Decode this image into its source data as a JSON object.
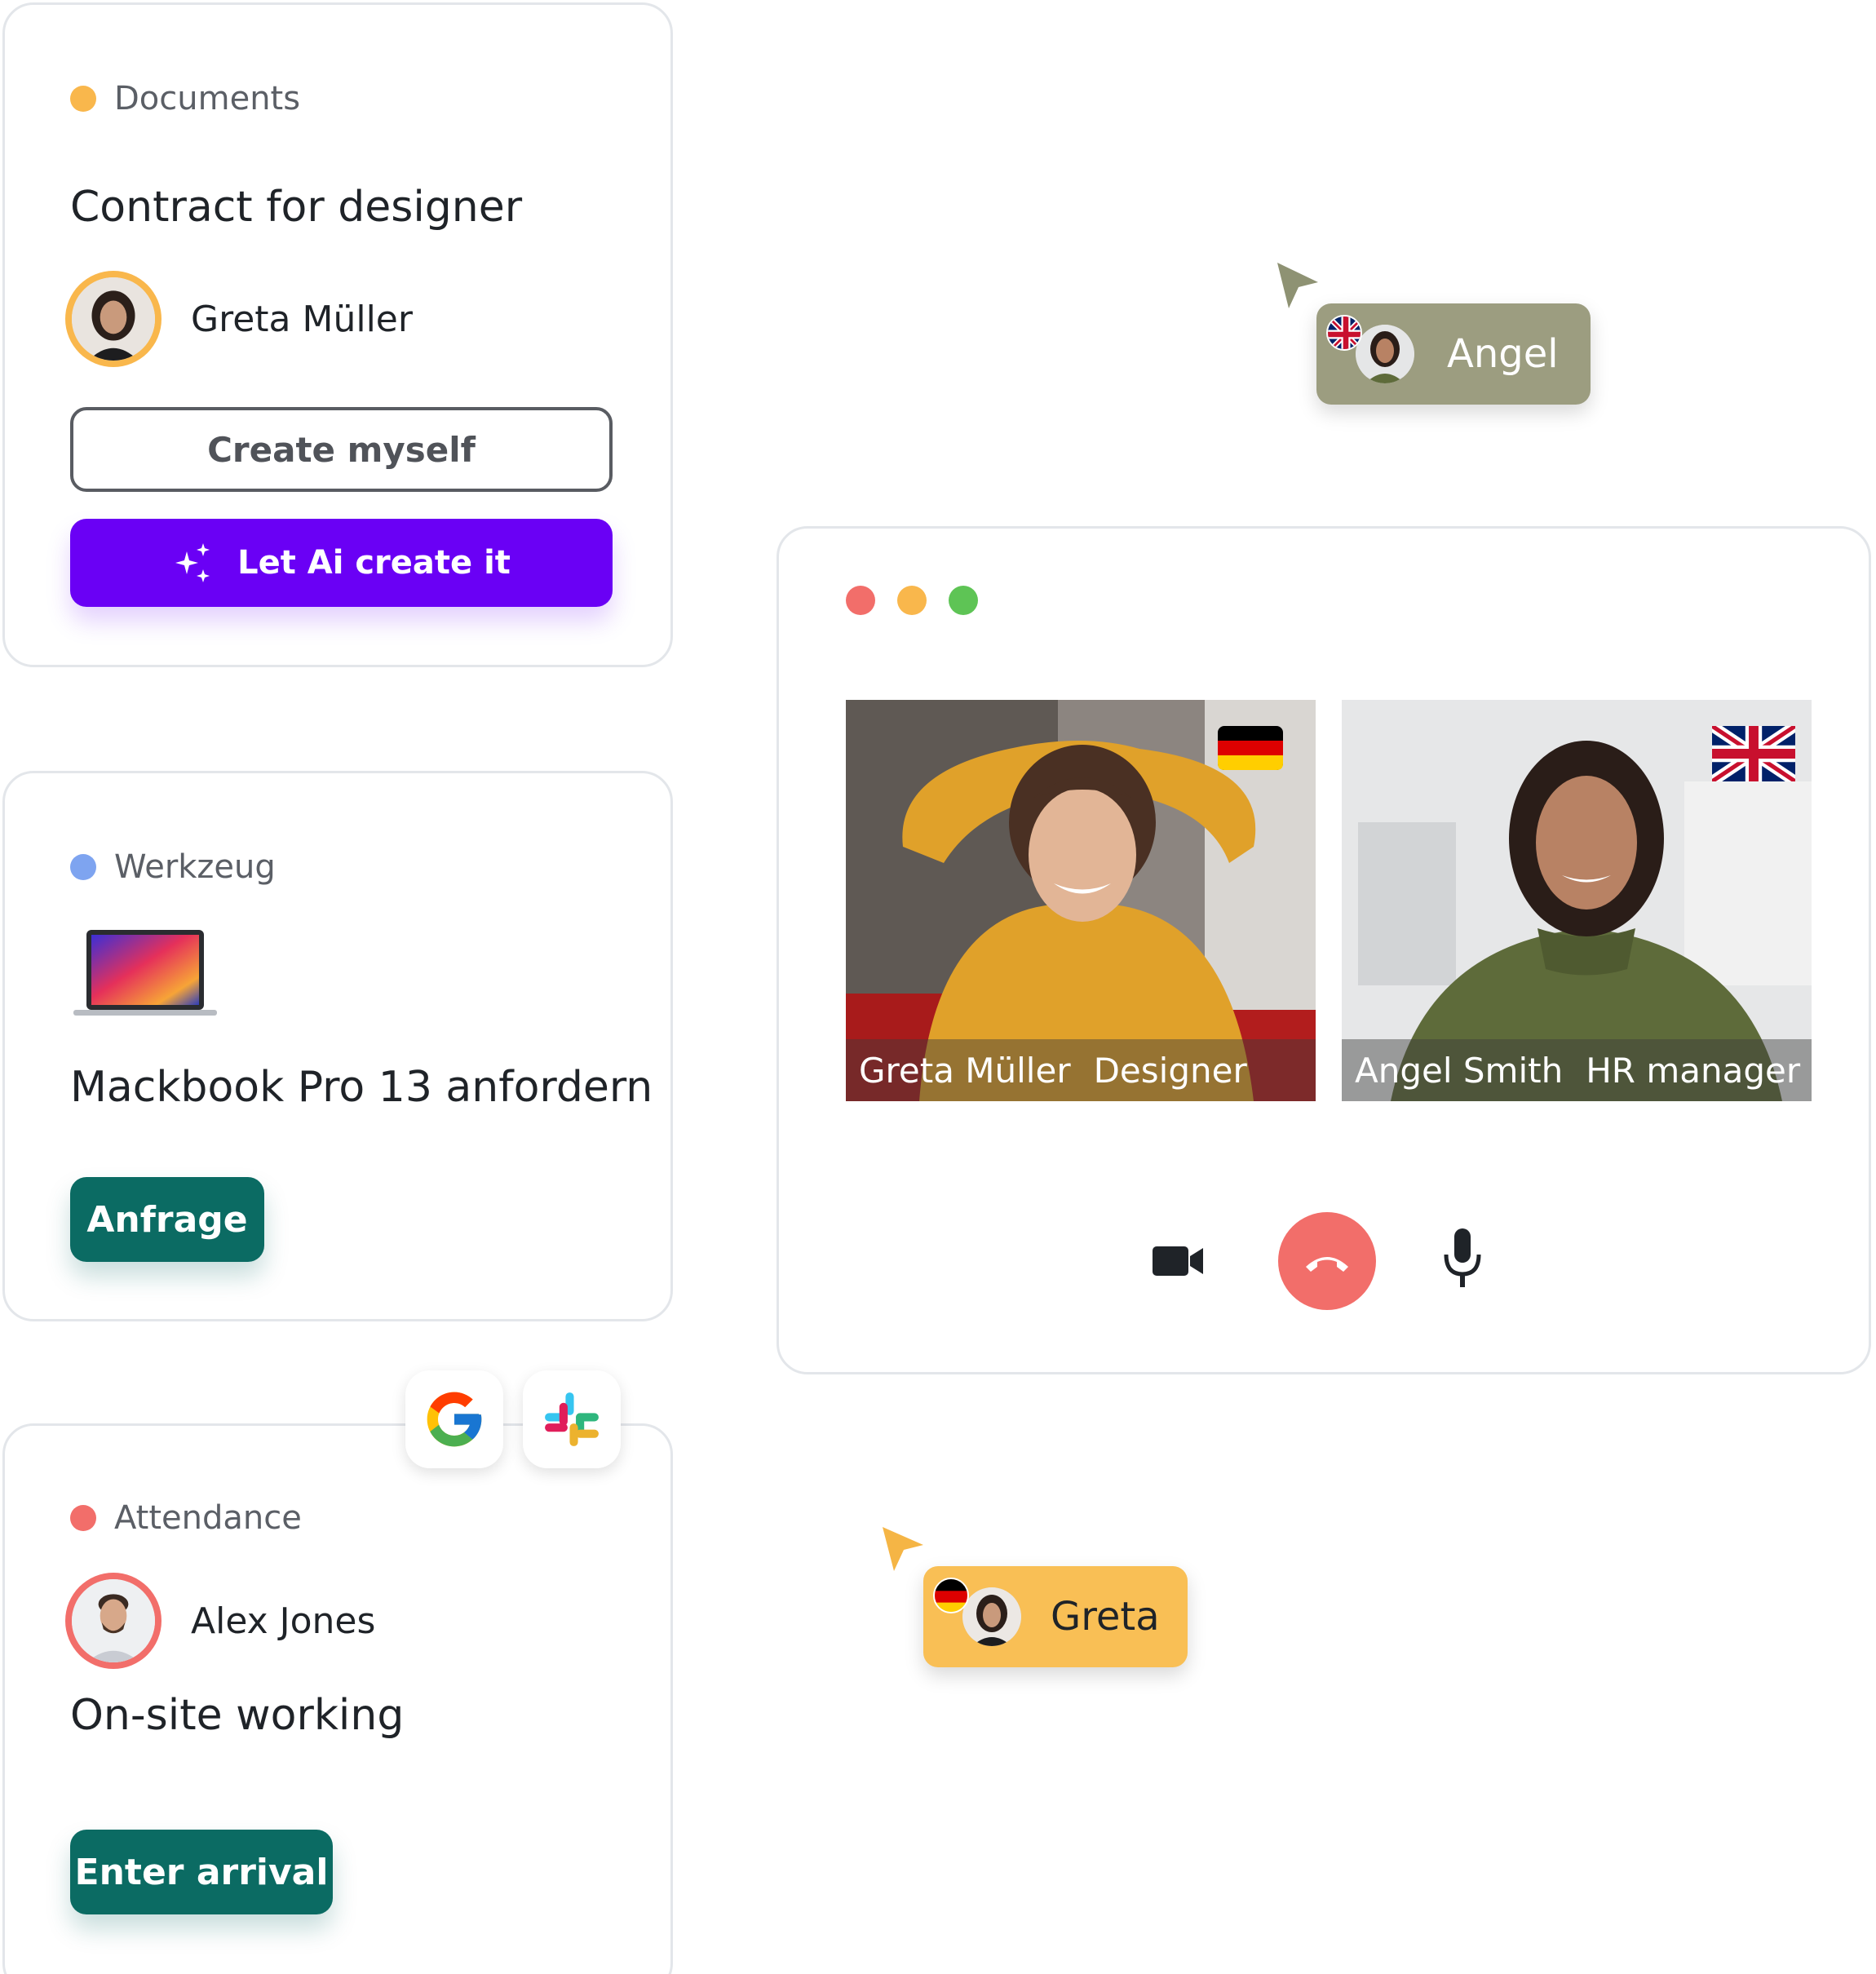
{
  "documents_card": {
    "category": "Documents",
    "title": "Contract for designer",
    "person": "Greta Müller",
    "create_myself": "Create myself",
    "let_ai": "Let Ai create it"
  },
  "werkzeug_card": {
    "category": "Werkzeug",
    "title": "Mackbook Pro 13 anfordern",
    "button": "Anfrage"
  },
  "attendance_card": {
    "category": "Attendance",
    "person": "Alex Jones",
    "title": "On-site working",
    "button": "Enter arrival"
  },
  "video_call": {
    "participants": [
      {
        "name": "Greta Müller",
        "role": "Designer"
      },
      {
        "name": "Angel Smith",
        "role": "HR manager"
      }
    ]
  },
  "cursor_tags": {
    "angel": "Angel",
    "greta": "Greta"
  },
  "colors": {
    "documents_dot": "#f9b74c",
    "werkzeug_dot": "#7ea4f0",
    "attendance_dot": "#f26e6a",
    "primary": "#6a00f5",
    "teal": "#0b6b63",
    "angel_tag": "#9c9d80",
    "greta_tag": "#f9bf55"
  }
}
